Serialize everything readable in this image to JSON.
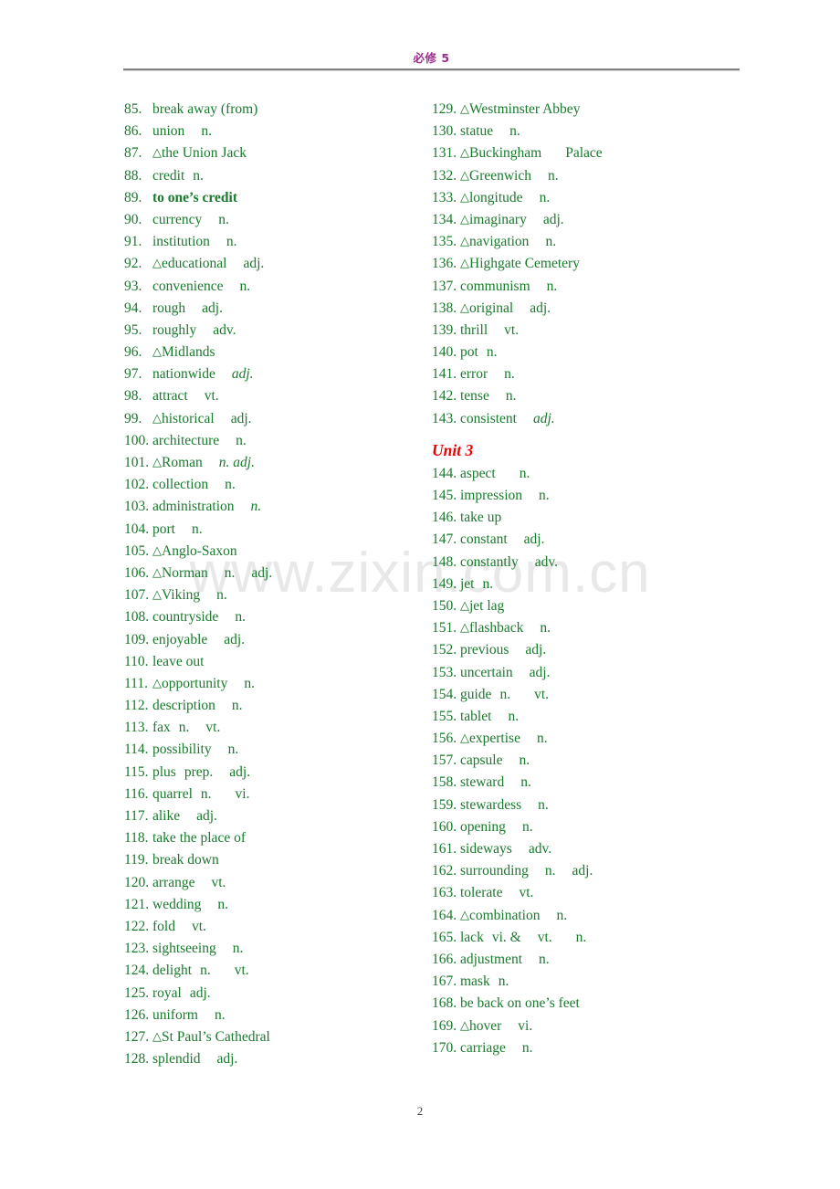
{
  "header": {
    "title": "必修 5",
    "title_color": "#9b2d8f",
    "rule_color": "#808080"
  },
  "watermark": {
    "text": "www.zixin.com.cn",
    "color": "#e8e8e8"
  },
  "footer": {
    "page_number": "2"
  },
  "colors": {
    "entry_green": "#1a7a2e",
    "unit_red": "#ee0000",
    "header_purple": "#9b2d8f"
  },
  "columns": {
    "left": [
      {
        "num": "85.",
        "triangle": false,
        "word": "break away (from)",
        "pos": "",
        "bold": false
      },
      {
        "num": "86.",
        "triangle": false,
        "word": "union",
        "pos": "n.",
        "bold": false,
        "gap": "sp2"
      },
      {
        "num": "87.",
        "triangle": true,
        "word": "the Union Jack",
        "pos": "",
        "bold": false
      },
      {
        "num": "88.",
        "triangle": false,
        "word": "credit",
        "pos": "n.",
        "bold": false,
        "gap": "sp1"
      },
      {
        "num": "89.",
        "triangle": false,
        "word": "to one’s credit",
        "pos": "",
        "bold": true
      },
      {
        "num": "90.",
        "triangle": false,
        "word": "currency",
        "pos": "n.",
        "bold": false,
        "gap": "sp2"
      },
      {
        "num": "91.",
        "triangle": false,
        "word": "institution",
        "pos": "n.",
        "bold": false,
        "gap": "sp2"
      },
      {
        "num": "92.",
        "triangle": true,
        "word": "educational",
        "pos": "adj.",
        "bold": false,
        "gap": "sp2"
      },
      {
        "num": "93.",
        "triangle": false,
        "word": "convenience",
        "pos": "n.",
        "bold": false,
        "gap": "sp2"
      },
      {
        "num": "94.",
        "triangle": false,
        "word": "rough",
        "pos": "adj.",
        "bold": false,
        "gap": "sp2"
      },
      {
        "num": "95.",
        "triangle": false,
        "word": "roughly",
        "pos": "adv.",
        "bold": false,
        "gap": "sp2"
      },
      {
        "num": "96.",
        "triangle": true,
        "word": "Midlands",
        "pos": "",
        "bold": false
      },
      {
        "num": "97.",
        "triangle": false,
        "word": "nationwide",
        "pos": "adj.",
        "bold": false,
        "italic_pos": true,
        "gap": "sp2"
      },
      {
        "num": "98.",
        "triangle": false,
        "word": "attract",
        "pos": "vt.",
        "bold": false,
        "gap": "sp2"
      },
      {
        "num": "99.",
        "triangle": true,
        "word": "historical",
        "pos": "adj.",
        "bold": false,
        "gap": "sp2"
      },
      {
        "num": "100.",
        "triangle": false,
        "word": "architecture",
        "pos": "n.",
        "bold": false,
        "gap": "sp2"
      },
      {
        "num": "101.",
        "triangle": true,
        "word": "Roman",
        "pos": "n. adj.",
        "bold": false,
        "italic_pos": true,
        "gap": "sp2"
      },
      {
        "num": "102.",
        "triangle": false,
        "word": "collection",
        "pos": "n.",
        "bold": false,
        "gap": "sp2"
      },
      {
        "num": "103.",
        "triangle": false,
        "word": "administration",
        "pos": "n.",
        "bold": false,
        "italic_pos": true,
        "gap": "sp2"
      },
      {
        "num": "104.",
        "triangle": false,
        "word": "port",
        "pos": "n.",
        "bold": false,
        "gap": "sp2"
      },
      {
        "num": "105.",
        "triangle": true,
        "word": "Anglo-Saxon",
        "pos": "",
        "bold": false
      },
      {
        "num": "106.",
        "triangle": true,
        "word": "Norman",
        "pos": "n.",
        "bold": false,
        "pos2": "adj.",
        "gap": "sp2"
      },
      {
        "num": "107.",
        "triangle": true,
        "word": "Viking",
        "pos": "n.",
        "bold": false,
        "gap": "sp2"
      },
      {
        "num": "108.",
        "triangle": false,
        "word": "countryside",
        "pos": "n.",
        "bold": false,
        "gap": "sp2"
      },
      {
        "num": "109.",
        "triangle": false,
        "word": "enjoyable",
        "pos": "adj.",
        "bold": false,
        "gap": "sp2"
      },
      {
        "num": "110.",
        "triangle": false,
        "word": "leave out",
        "pos": "",
        "bold": false
      },
      {
        "num": "111.",
        "triangle": true,
        "word": "opportunity",
        "pos": "n.",
        "bold": false,
        "gap": "sp2"
      },
      {
        "num": "112.",
        "triangle": false,
        "word": "description",
        "pos": "n.",
        "bold": false,
        "gap": "sp2"
      },
      {
        "num": "113.",
        "triangle": false,
        "word": "fax",
        "pos": "n.",
        "bold": false,
        "pos2": "vt.",
        "gap": "sp1"
      },
      {
        "num": "114.",
        "triangle": false,
        "word": "possibility",
        "pos": "n.",
        "bold": false,
        "gap": "sp2"
      },
      {
        "num": "115.",
        "triangle": false,
        "word": "plus",
        "pos": "prep.",
        "bold": false,
        "pos2": "adj.",
        "gap": "sp1"
      },
      {
        "num": "116.",
        "triangle": false,
        "word": "quarrel",
        "pos": "n.",
        "bold": false,
        "pos2": "vi.",
        "pos2gap": "sp3",
        "gap": "sp1"
      },
      {
        "num": "117.",
        "triangle": false,
        "word": "alike",
        "pos": "adj.",
        "bold": false,
        "gap": "sp2"
      },
      {
        "num": "118.",
        "triangle": false,
        "word": "take the place of",
        "pos": "",
        "bold": false
      },
      {
        "num": "119.",
        "triangle": false,
        "word": "break down",
        "pos": "",
        "bold": false
      },
      {
        "num": "120.",
        "triangle": false,
        "word": "arrange",
        "pos": "vt.",
        "bold": false,
        "gap": "sp2"
      },
      {
        "num": "121.",
        "triangle": false,
        "word": "wedding",
        "pos": "n.",
        "bold": false,
        "gap": "sp2"
      },
      {
        "num": "122.",
        "triangle": false,
        "word": "fold",
        "pos": "vt.",
        "bold": false,
        "gap": "sp2"
      },
      {
        "num": "123.",
        "triangle": false,
        "word": "sightseeing",
        "pos": "n.",
        "bold": false,
        "gap": "sp2"
      },
      {
        "num": "124.",
        "triangle": false,
        "word": "delight",
        "pos": "n.",
        "bold": false,
        "pos2": "vt.",
        "pos2gap": "sp3",
        "gap": "sp1"
      },
      {
        "num": "125.",
        "triangle": false,
        "word": "royal",
        "pos": "adj.",
        "bold": false,
        "gap": "sp1"
      },
      {
        "num": "126.",
        "triangle": false,
        "word": "uniform",
        "pos": "n.",
        "bold": false,
        "gap": "sp2"
      },
      {
        "num": "127.",
        "triangle": true,
        "word": "St Paul’s Cathedral",
        "pos": "",
        "bold": false
      },
      {
        "num": "128.",
        "triangle": false,
        "word": "splendid",
        "pos": "adj.",
        "bold": false,
        "gap": "sp2"
      }
    ],
    "right": [
      {
        "num": "129.",
        "triangle": true,
        "word": "Westminster Abbey",
        "pos": "",
        "bold": false
      },
      {
        "num": "130.",
        "triangle": false,
        "word": "statue",
        "pos": "n.",
        "bold": false,
        "gap": "sp2"
      },
      {
        "num": "131.",
        "triangle": true,
        "word": "Buckingham",
        "pos": "Palace",
        "bold": false,
        "gap": "sp3"
      },
      {
        "num": "132.",
        "triangle": true,
        "word": "Greenwich",
        "pos": "n.",
        "bold": false,
        "gap": "sp2"
      },
      {
        "num": "133.",
        "triangle": true,
        "word": "longitude",
        "pos": "n.",
        "bold": false,
        "gap": "sp2"
      },
      {
        "num": "134.",
        "triangle": true,
        "word": "imaginary",
        "pos": "adj.",
        "bold": false,
        "gap": "sp2"
      },
      {
        "num": "135.",
        "triangle": true,
        "word": "navigation",
        "pos": "n.",
        "bold": false,
        "gap": "sp2"
      },
      {
        "num": "136.",
        "triangle": true,
        "word": "Highgate Cemetery",
        "pos": "",
        "bold": false
      },
      {
        "num": "137.",
        "triangle": false,
        "word": "communism",
        "pos": "n.",
        "bold": false,
        "gap": "sp2"
      },
      {
        "num": "138.",
        "triangle": true,
        "word": "original",
        "pos": "adj.",
        "bold": false,
        "gap": "sp2"
      },
      {
        "num": "139.",
        "triangle": false,
        "word": "thrill",
        "pos": "vt.",
        "bold": false,
        "gap": "sp2"
      },
      {
        "num": "140.",
        "triangle": false,
        "word": "pot",
        "pos": "n.",
        "bold": false,
        "gap": "sp1"
      },
      {
        "num": "141.",
        "triangle": false,
        "word": "error",
        "pos": "n.",
        "bold": false,
        "gap": "sp2"
      },
      {
        "num": "142.",
        "triangle": false,
        "word": "tense",
        "pos": "n.",
        "bold": false,
        "gap": "sp2"
      },
      {
        "num": "143.",
        "triangle": false,
        "word": "consistent",
        "pos": "adj.",
        "bold": false,
        "italic_pos": true,
        "gap": "sp2"
      },
      {
        "heading": "Unit 3"
      },
      {
        "num": "144.",
        "triangle": false,
        "word": "aspect",
        "pos": "n.",
        "bold": false,
        "gap": "sp3"
      },
      {
        "num": "145.",
        "triangle": false,
        "word": "impression",
        "pos": "n.",
        "bold": false,
        "gap": "sp2"
      },
      {
        "num": "146.",
        "triangle": false,
        "word": "take up",
        "pos": "",
        "bold": false
      },
      {
        "num": "147.",
        "triangle": false,
        "word": "constant",
        "pos": "adj.",
        "bold": false,
        "gap": "sp2"
      },
      {
        "num": "148.",
        "triangle": false,
        "word": "constantly",
        "pos": "adv.",
        "bold": false,
        "gap": "sp2"
      },
      {
        "num": "149.",
        "triangle": false,
        "word": "jet",
        "pos": "n.",
        "bold": false,
        "gap": "sp1"
      },
      {
        "num": "150.",
        "triangle": true,
        "word": "jet lag",
        "pos": "",
        "bold": false
      },
      {
        "num": "151.",
        "triangle": true,
        "word": "flashback",
        "pos": "n.",
        "bold": false,
        "gap": "sp2"
      },
      {
        "num": "152.",
        "triangle": false,
        "word": "previous",
        "pos": "adj.",
        "bold": false,
        "gap": "sp2"
      },
      {
        "num": "153.",
        "triangle": false,
        "word": "uncertain",
        "pos": "adj.",
        "bold": false,
        "gap": "sp2"
      },
      {
        "num": "154.",
        "triangle": false,
        "word": "guide",
        "pos": "n.",
        "bold": false,
        "pos2": "vt.",
        "pos2gap": "sp3",
        "gap": "sp1"
      },
      {
        "num": "155.",
        "triangle": false,
        "word": "tablet",
        "pos": "n.",
        "bold": false,
        "gap": "sp2"
      },
      {
        "num": "156.",
        "triangle": true,
        "word": "expertise",
        "pos": "n.",
        "bold": false,
        "gap": "sp2"
      },
      {
        "num": "157.",
        "triangle": false,
        "word": "capsule",
        "pos": "n.",
        "bold": false,
        "gap": "sp2"
      },
      {
        "num": "158.",
        "triangle": false,
        "word": "steward",
        "pos": "n.",
        "bold": false,
        "gap": "sp2"
      },
      {
        "num": "159.",
        "triangle": false,
        "word": "stewardess",
        "pos": "n.",
        "bold": false,
        "gap": "sp2"
      },
      {
        "num": "160.",
        "triangle": false,
        "word": "opening",
        "pos": "n.",
        "bold": false,
        "gap": "sp2"
      },
      {
        "num": "161.",
        "triangle": false,
        "word": "sideways",
        "pos": "adv.",
        "bold": false,
        "gap": "sp2"
      },
      {
        "num": "162.",
        "triangle": false,
        "word": "surrounding",
        "pos": "n.",
        "bold": false,
        "pos2": "adj.",
        "gap": "sp2"
      },
      {
        "num": "163.",
        "triangle": false,
        "word": "tolerate",
        "pos": "vt.",
        "bold": false,
        "gap": "sp2"
      },
      {
        "num": "164.",
        "triangle": true,
        "word": "combination",
        "pos": "n.",
        "bold": false,
        "gap": "sp2"
      },
      {
        "num": "165.",
        "triangle": false,
        "word": "lack",
        "pos": "vi. &",
        "bold": false,
        "pos2": "vt.",
        "pos3": "n.",
        "gap": "sp1"
      },
      {
        "num": "166.",
        "triangle": false,
        "word": "adjustment",
        "pos": "n.",
        "bold": false,
        "gap": "sp2"
      },
      {
        "num": "167.",
        "triangle": false,
        "word": "mask",
        "pos": "n.",
        "bold": false,
        "gap": "sp1"
      },
      {
        "num": "168.",
        "triangle": false,
        "word": "be back on one’s feet",
        "pos": "",
        "bold": false
      },
      {
        "num": "169.",
        "triangle": true,
        "word": "hover",
        "pos": "vi.",
        "bold": false,
        "gap": "sp2"
      },
      {
        "num": "170.",
        "triangle": false,
        "word": "carriage",
        "pos": "n.",
        "bold": false,
        "gap": "sp2"
      }
    ]
  }
}
